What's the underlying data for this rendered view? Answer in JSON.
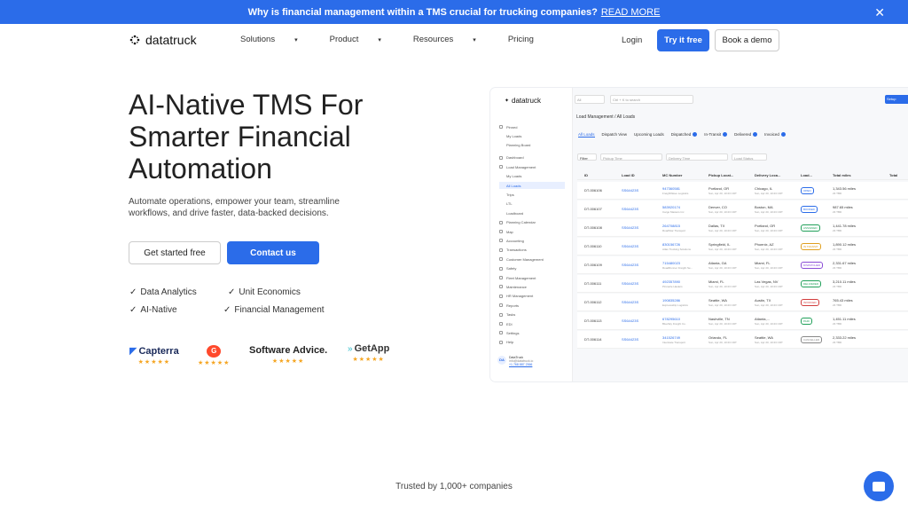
{
  "banner": {
    "text": "Why is financial management within a TMS crucial for trucking companies?",
    "link": "READ MORE"
  },
  "nav": {
    "logo": "datatruck",
    "menu": [
      {
        "label": "Solutions",
        "dropdown": true
      },
      {
        "label": "Product",
        "dropdown": true
      },
      {
        "label": "Resources",
        "dropdown": true
      },
      {
        "label": "Pricing",
        "dropdown": false
      }
    ],
    "login": "Login",
    "try": "Try it free",
    "demo": "Book a demo"
  },
  "hero": {
    "title": "AI-Native TMS For Smarter Financial Automation",
    "subtitle": "Automate operations, empower your team, streamline workflows, and drive faster, data-backed decisions.",
    "cta_primary": "Get started free",
    "cta_secondary": "Contact us",
    "features": [
      "Data Analytics",
      "Unit Economics",
      "AI-Native",
      "Financial Management"
    ],
    "reviews": [
      "Capterra",
      "Software Advice.",
      "GetApp"
    ]
  },
  "trusted": "Trusted by 1,000+ companies",
  "colors": {
    "accent": "#2b6ce9",
    "star": "#f5a623"
  },
  "app": {
    "logo": "datatruck",
    "select": "All",
    "search": "Ctrl + K to search",
    "setup": "Setup",
    "breadcrumb": "Load Management  /  All Loads",
    "sidebar": [
      {
        "label": "Pinned",
        "type": "head"
      },
      {
        "label": "My Loads",
        "type": "sub"
      },
      {
        "label": "Planning Board",
        "type": "sub"
      },
      {
        "label": "Dashboard",
        "type": "item"
      },
      {
        "label": "Load Management",
        "type": "item"
      },
      {
        "label": "My Loads",
        "type": "sub"
      },
      {
        "label": "All Loads",
        "type": "sub",
        "selected": true
      },
      {
        "label": "Trips",
        "type": "sub"
      },
      {
        "label": "LTL",
        "type": "sub"
      },
      {
        "label": "Loadboard",
        "type": "sub"
      },
      {
        "label": "Planning Calendar",
        "type": "item"
      },
      {
        "label": "Map",
        "type": "item"
      },
      {
        "label": "Accounting",
        "type": "item"
      },
      {
        "label": "Transactions",
        "type": "item"
      },
      {
        "label": "Customer Management",
        "type": "item"
      },
      {
        "label": "Safety",
        "type": "item"
      },
      {
        "label": "Fleet Management",
        "type": "item"
      },
      {
        "label": "Maintenance",
        "type": "item"
      },
      {
        "label": "HR Management",
        "type": "item"
      },
      {
        "label": "Reports",
        "type": "item"
      },
      {
        "label": "Tasks",
        "type": "item"
      },
      {
        "label": "EDI",
        "type": "item"
      },
      {
        "label": "Settings",
        "type": "item"
      },
      {
        "label": "Help",
        "type": "item"
      }
    ],
    "user": {
      "initials": "DA",
      "name": "DataTruck",
      "email": "info@datatruck.io",
      "phone": "+1 768 887 2366"
    },
    "tabs": [
      "All Loads",
      "Dispatch View",
      "Upcoming Loads",
      "Dispatched",
      "In-Transit",
      "Delivered",
      "Invoiced"
    ],
    "filters": [
      "Filter",
      "Pickup Time",
      "Delivery Time",
      "Load Status"
    ],
    "columns": [
      "ID",
      "Load ID",
      "MC Number",
      "Pickup Locat...",
      "Delivery Loca...",
      "Load...",
      "Total miles",
      "Total"
    ],
    "rows": [
      {
        "id": "DT-006106",
        "load": "SS64423S",
        "mc": "947360581",
        "mcsub": "FreightWave Logistics",
        "pick": "Portland, OR",
        "pickt": "Sun, Apr 20, 10:23 CDT",
        "del": "Chicago, IL",
        "delt": "Sun, Apr 20, 10:23 CDT",
        "status": "OPEN",
        "scol": "#2b6ce9",
        "miles": "1,343.56 miles",
        "msub": "23 TBD"
      },
      {
        "id": "DT-006107",
        "load": "SS64423S",
        "mc": "583920174",
        "mcsub": "Cargo Masters Inc",
        "pick": "Denver, CO",
        "pickt": "Sun, Apr 20, 10:23 CDT",
        "del": "Boston, MA",
        "delt": "Sun, Apr 20, 10:23 CDT",
        "status": "BOOKED",
        "scol": "#2b6ce9",
        "miles": "987.65 miles",
        "msub": "23 TBD"
      },
      {
        "id": "DT-006108",
        "load": "SS64423S",
        "mc": "264708815",
        "mcsub": "RoadStar Transport",
        "pick": "Dallas, TX",
        "pickt": "Sun, Apr 20, 10:23 CDT",
        "del": "Portland, OR",
        "delt": "Sun, Apr 20, 10:23 CDT",
        "status": "ASSIGNED",
        "scol": "#21a05a",
        "miles": "1,441.78 miles",
        "msub": "23 TBD"
      },
      {
        "id": "DT-006110",
        "load": "SS64423S",
        "mc": "830156726",
        "mcsub": "Atlas Trucking Solutions",
        "pick": "Springfield, IL",
        "pickt": "Sun, Apr 20, 10:23 CDT",
        "del": "Phoenix, AZ",
        "delt": "Sun, Apr 20, 10:23 CDT",
        "status": "IN TRANSIT",
        "scol": "#e0a020",
        "miles": "1,890.12 miles",
        "msub": "23 TBD"
      },
      {
        "id": "DT-006109",
        "load": "SS64423S",
        "mc": "715480023",
        "mcsub": "RoadRunner Freight Se...",
        "pick": "Atlanta, GA",
        "pickt": "Sun, Apr 20, 10:23 CDT",
        "del": "Miami, FL",
        "delt": "Sun, Apr 20, 10:23 CDT",
        "status": "DISPATCHED",
        "scol": "#8a4bd6",
        "miles": "2,331.67 miles",
        "msub": "23 TBD"
      },
      {
        "id": "DT-006111",
        "load": "SS64423S",
        "mc": "492357890",
        "mcsub": "Pinnacle Haulers",
        "pick": "Miami, FL",
        "pickt": "Sun, Apr 20, 10:23 CDT",
        "del": "Las Vegas, NV",
        "delt": "Sun, Apr 20, 10:23 CDT",
        "status": "DELIVERED",
        "scol": "#21a05a",
        "miles": "3,210.11 miles",
        "msub": "23 TBD"
      },
      {
        "id": "DT-006112",
        "load": "SS64423S",
        "mc": "190835286",
        "mcsub": "Expressship Logistics",
        "pick": "Seattle, WA",
        "pickt": "Sun, Apr 20, 10:23 CDT",
        "del": "Austin, TX",
        "delt": "Sun, Apr 20, 10:23 CDT",
        "status": "INVOICED",
        "scol": "#d23c3c",
        "miles": "765.43 miles",
        "msub": "23 TBD"
      },
      {
        "id": "DT-006113",
        "load": "SS64423S",
        "mc": "678295610",
        "mcsub": "BlueSky Freight Co.",
        "pick": "Nashville, TN",
        "pickt": "Sun, Apr 20, 10:23 CDT",
        "del": "Atlanta,...",
        "delt": "Sun, Apr 20, 10:23 CDT",
        "status": "PAID",
        "scol": "#21a05a",
        "miles": "1,451.11 miles",
        "msub": "23 TBD"
      },
      {
        "id": "DT-006114",
        "load": "SS64423S",
        "mc": "341526749",
        "mcsub": "Interstate Transport",
        "pick": "Orlando, FL",
        "pickt": "Sun, Apr 20, 10:23 CDT",
        "del": "Seattle, WA",
        "delt": "Sun, Apr 20, 10:23 CDT",
        "status": "CANCELLED",
        "scol": "#888888",
        "miles": "2,333.22 miles",
        "msub": "23 TBD"
      }
    ]
  }
}
